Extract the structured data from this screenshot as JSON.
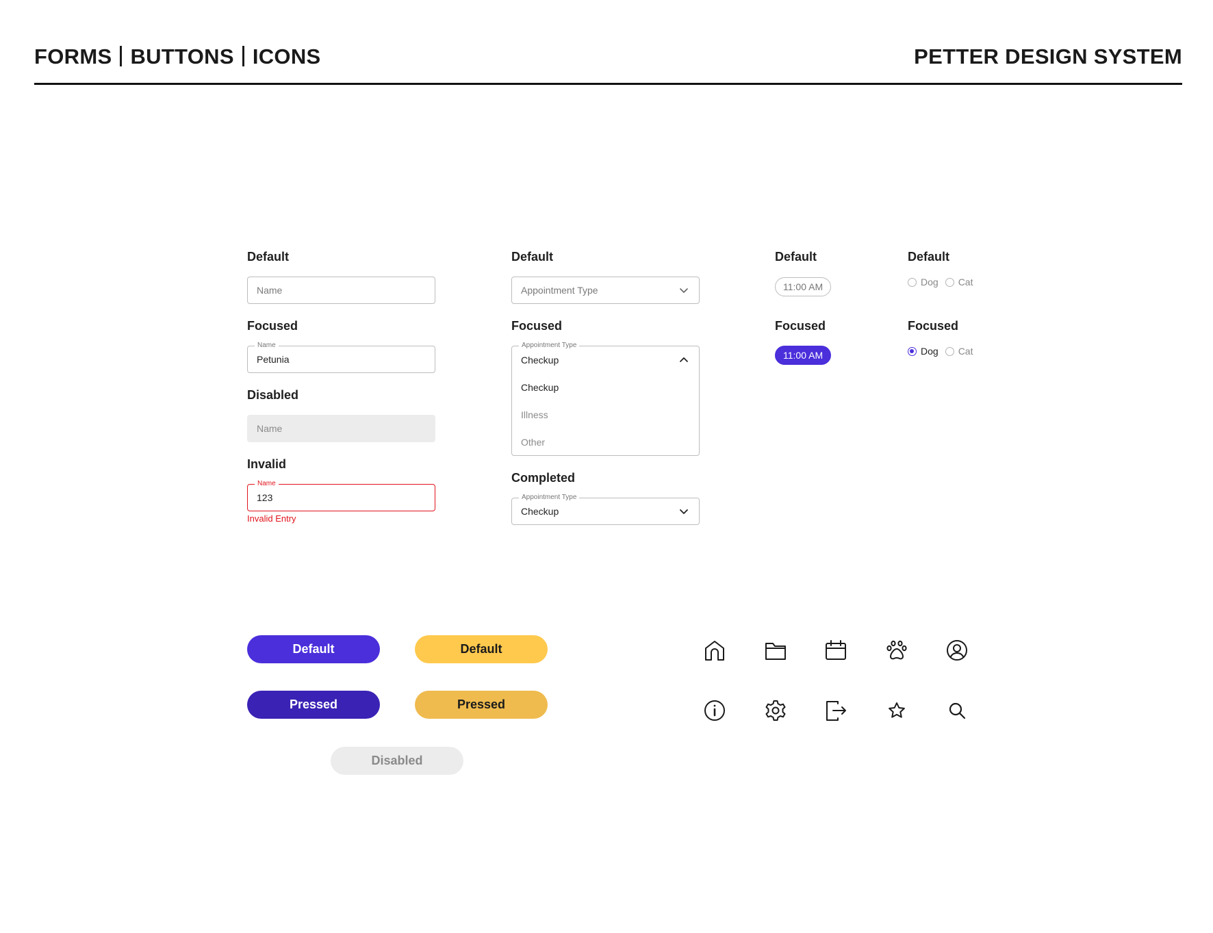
{
  "header": {
    "left": [
      "FORMS",
      "BUTTONS",
      "ICONS"
    ],
    "right": "PETTER DESIGN SYSTEM"
  },
  "text_inputs": {
    "default": {
      "label": "Default",
      "placeholder": "Name"
    },
    "focused": {
      "label": "Focused",
      "float_label": "Name",
      "value": "Petunia"
    },
    "disabled": {
      "label": "Disabled",
      "placeholder": "Name"
    },
    "invalid": {
      "label": "Invalid",
      "float_label": "Name",
      "value": "123",
      "error": "Invalid Entry"
    }
  },
  "dropdowns": {
    "default": {
      "label": "Default",
      "placeholder": "Appointment Type"
    },
    "focused": {
      "label": "Focused",
      "float_label": "Appointment Type",
      "value": "Checkup",
      "options": [
        "Checkup",
        "Illness",
        "Other"
      ]
    },
    "completed": {
      "label": "Completed",
      "float_label": "Appointment Type",
      "value": "Checkup"
    }
  },
  "time_chips": {
    "default": {
      "label": "Default",
      "value": "11:00 AM"
    },
    "focused": {
      "label": "Focused",
      "value": "11:00 AM"
    }
  },
  "radios": {
    "default": {
      "label": "Default",
      "options": [
        "Dog",
        "Cat"
      ],
      "selected": null
    },
    "focused": {
      "label": "Focused",
      "options": [
        "Dog",
        "Cat"
      ],
      "selected": "Dog"
    }
  },
  "buttons": {
    "primary_default": "Default",
    "secondary_default": "Default",
    "primary_pressed": "Pressed",
    "secondary_pressed": "Pressed",
    "disabled": "Disabled"
  },
  "icons": {
    "row1": [
      "home-icon",
      "folder-icon",
      "calendar-icon",
      "paw-icon",
      "user-circle-icon"
    ],
    "row2": [
      "info-icon",
      "gear-icon",
      "logout-icon",
      "star-icon",
      "search-icon"
    ]
  },
  "colors": {
    "primary": "#4a2fdb",
    "primary_pressed": "#3a22b5",
    "secondary": "#ffc94d",
    "secondary_pressed": "#efbb4e",
    "error": "#e1141c",
    "disabled_bg": "#ececec"
  }
}
